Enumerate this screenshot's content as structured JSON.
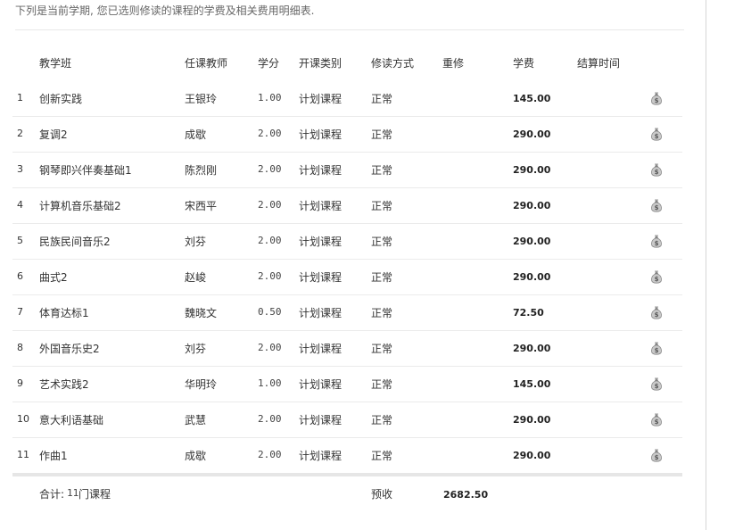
{
  "intro": "下列是当前学期, 您已选则修读的课程的学费及相关费用明细表.",
  "headers": {
    "course": "教学班",
    "teacher": "任课教师",
    "credit": "学分",
    "type": "开课类别",
    "mode": "修读方式",
    "retake": "重修",
    "fee": "学费",
    "settle": "结算时间"
  },
  "rows": [
    {
      "index": "1",
      "course": "创新实践",
      "teacher": "王银玲",
      "credit": "1.00",
      "type": "计划课程",
      "mode": "正常",
      "fee": "145.00"
    },
    {
      "index": "2",
      "course": "复调2",
      "teacher": "成歇",
      "credit": "2.00",
      "type": "计划课程",
      "mode": "正常",
      "fee": "290.00"
    },
    {
      "index": "3",
      "course": "钢琴即兴伴奏基础1",
      "teacher": "陈烈刚",
      "credit": "2.00",
      "type": "计划课程",
      "mode": "正常",
      "fee": "290.00"
    },
    {
      "index": "4",
      "course": "计算机音乐基础2",
      "teacher": "宋西平",
      "credit": "2.00",
      "type": "计划课程",
      "mode": "正常",
      "fee": "290.00"
    },
    {
      "index": "5",
      "course": "民族民间音乐2",
      "teacher": "刘芬",
      "credit": "2.00",
      "type": "计划课程",
      "mode": "正常",
      "fee": "290.00"
    },
    {
      "index": "6",
      "course": "曲式2",
      "teacher": "赵峻",
      "credit": "2.00",
      "type": "计划课程",
      "mode": "正常",
      "fee": "290.00"
    },
    {
      "index": "7",
      "course": "体育达标1",
      "teacher": "魏晓文",
      "credit": "0.50",
      "type": "计划课程",
      "mode": "正常",
      "fee": "72.50"
    },
    {
      "index": "8",
      "course": "外国音乐史2",
      "teacher": "刘芬",
      "credit": "2.00",
      "type": "计划课程",
      "mode": "正常",
      "fee": "290.00"
    },
    {
      "index": "9",
      "course": "艺术实践2",
      "teacher": "华明玲",
      "credit": "1.00",
      "type": "计划课程",
      "mode": "正常",
      "fee": "145.00"
    },
    {
      "index": "10",
      "course": "意大利语基础",
      "teacher": "武慧",
      "credit": "2.00",
      "type": "计划课程",
      "mode": "正常",
      "fee": "290.00"
    },
    {
      "index": "11",
      "course": "作曲1",
      "teacher": "成歇",
      "credit": "2.00",
      "type": "计划课程",
      "mode": "正常",
      "fee": "290.00"
    }
  ],
  "footer": {
    "total_label": "合计: ",
    "total_count": "11",
    "total_suffix": " 门课程",
    "prepay_label": "预收",
    "prepay_amount": "2682.50"
  },
  "icons": {
    "row_action": "money-bag-icon"
  },
  "colors": {
    "text": "#333333",
    "separator": "#ebebeb",
    "icon": "#8a8a8a"
  }
}
